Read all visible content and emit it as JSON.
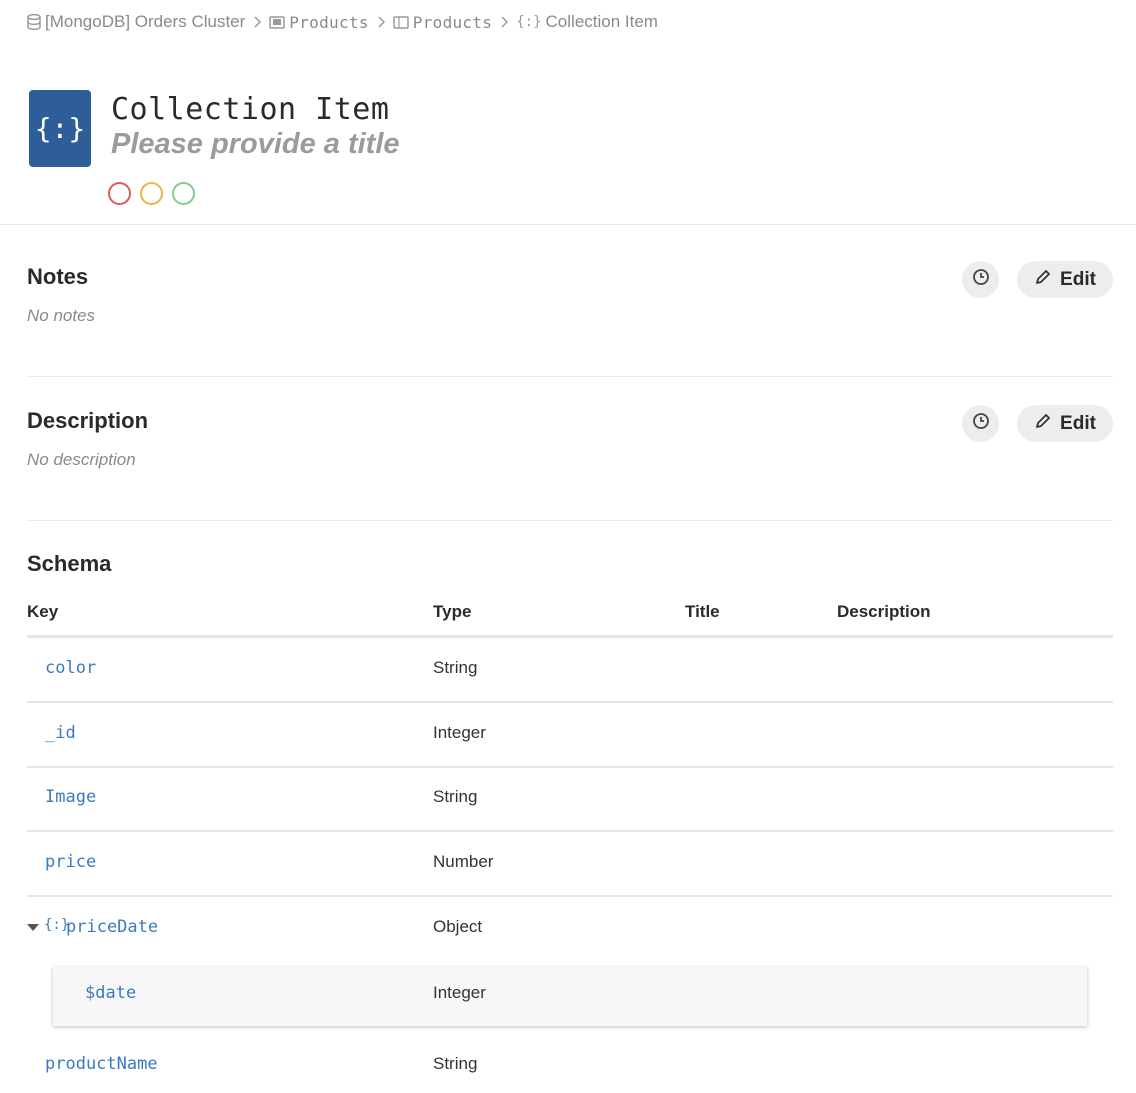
{
  "breadcrumb": [
    {
      "label": "[MongoDB] Orders Cluster",
      "icon": "database-icon"
    },
    {
      "label": "Products",
      "icon": "schema-icon"
    },
    {
      "label": "Products",
      "icon": "collection-icon"
    },
    {
      "label": "Collection Item",
      "icon": "object-braces-icon"
    }
  ],
  "header": {
    "icon_glyph": "{:}",
    "title": "Collection Item",
    "subtitle_placeholder": "Please provide a title",
    "status_colors": [
      "#e05a5a",
      "#efb14a",
      "#88c98d"
    ]
  },
  "notes": {
    "title": "Notes",
    "empty_text": "No notes",
    "edit_label": "Edit"
  },
  "description": {
    "title": "Description",
    "empty_text": "No description",
    "edit_label": "Edit"
  },
  "schema": {
    "title": "Schema",
    "columns": [
      "Key",
      "Type",
      "Title",
      "Description"
    ],
    "rows": [
      {
        "key": "color",
        "type": "String"
      },
      {
        "key": "_id",
        "type": "Integer"
      },
      {
        "key": "Image",
        "type": "String"
      },
      {
        "key": "price",
        "type": "Number"
      },
      {
        "key": "priceDate",
        "type": "Object",
        "expanded": true,
        "icon": "{:}",
        "children": [
          {
            "key": "$date",
            "type": "Integer"
          }
        ]
      },
      {
        "key": "productName",
        "type": "String"
      }
    ]
  },
  "colors": {
    "accent": "#2e5e97",
    "link": "#3a7bbf"
  }
}
